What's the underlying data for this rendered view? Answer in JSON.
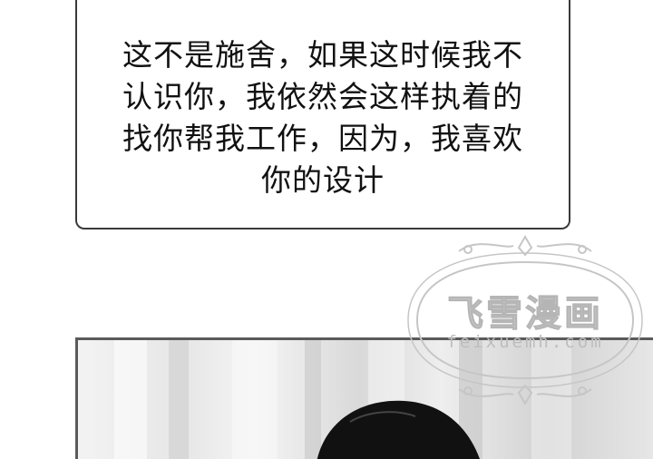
{
  "bubble": {
    "lines": [
      "这不是施舍，如果这时候我不",
      "认识你，我依然会这样执着的",
      "找你帮我工作，因为，我喜欢",
      "你的设计"
    ]
  },
  "watermark": {
    "title": "飞雪漫画",
    "url": "feixuemh.com"
  }
}
